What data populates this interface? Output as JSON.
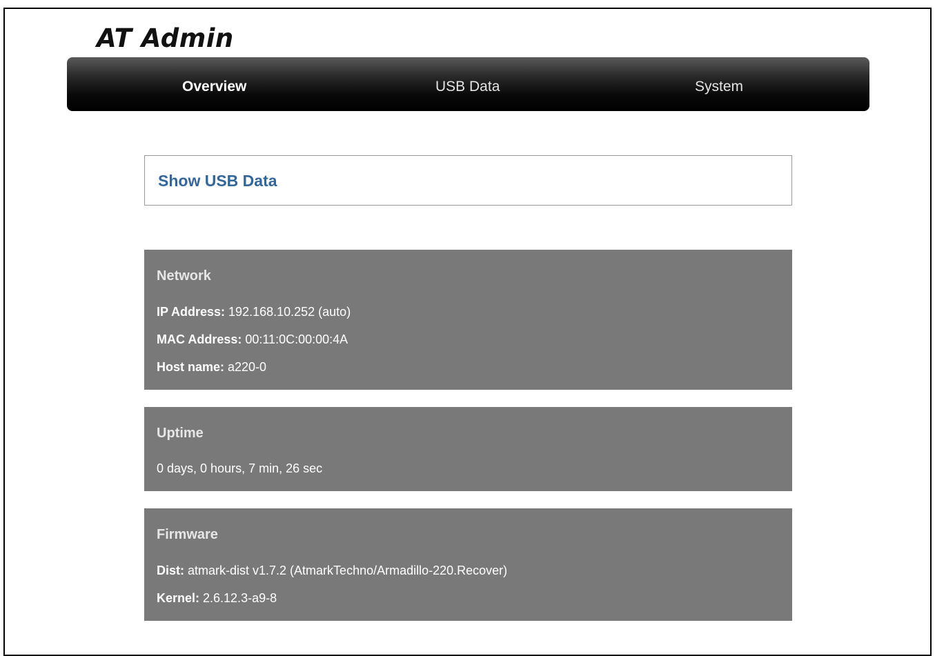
{
  "app": {
    "title": "AT Admin"
  },
  "nav": {
    "tabs": [
      {
        "label": "Overview",
        "active": true
      },
      {
        "label": "USB Data",
        "active": false
      },
      {
        "label": "System",
        "active": false
      }
    ]
  },
  "main": {
    "link_box": {
      "label": "Show USB Data",
      "color": "#336699"
    },
    "network": {
      "heading": "Network",
      "ip_label": "IP Address:",
      "ip_value": " 192.168.10.252 (auto)",
      "mac_label": "MAC Address:",
      "mac_value": " 00:11:0C:00:00:4A",
      "host_label": "Host name:",
      "host_value": " a220-0"
    },
    "uptime": {
      "heading": "Uptime",
      "value": "0 days, 0 hours, 7 min, 26 sec"
    },
    "firmware": {
      "heading": "Firmware",
      "dist_label": "Dist:",
      "dist_value": " atmark-dist v1.7.2 (AtmarkTechno/Armadillo-220.Recover)",
      "kernel_label": "Kernel:",
      "kernel_value": " 2.6.12.3-a9-8"
    }
  },
  "colors": {
    "panel_bg": "#797979",
    "navbar_bg": "#000000",
    "link": "#336699"
  }
}
